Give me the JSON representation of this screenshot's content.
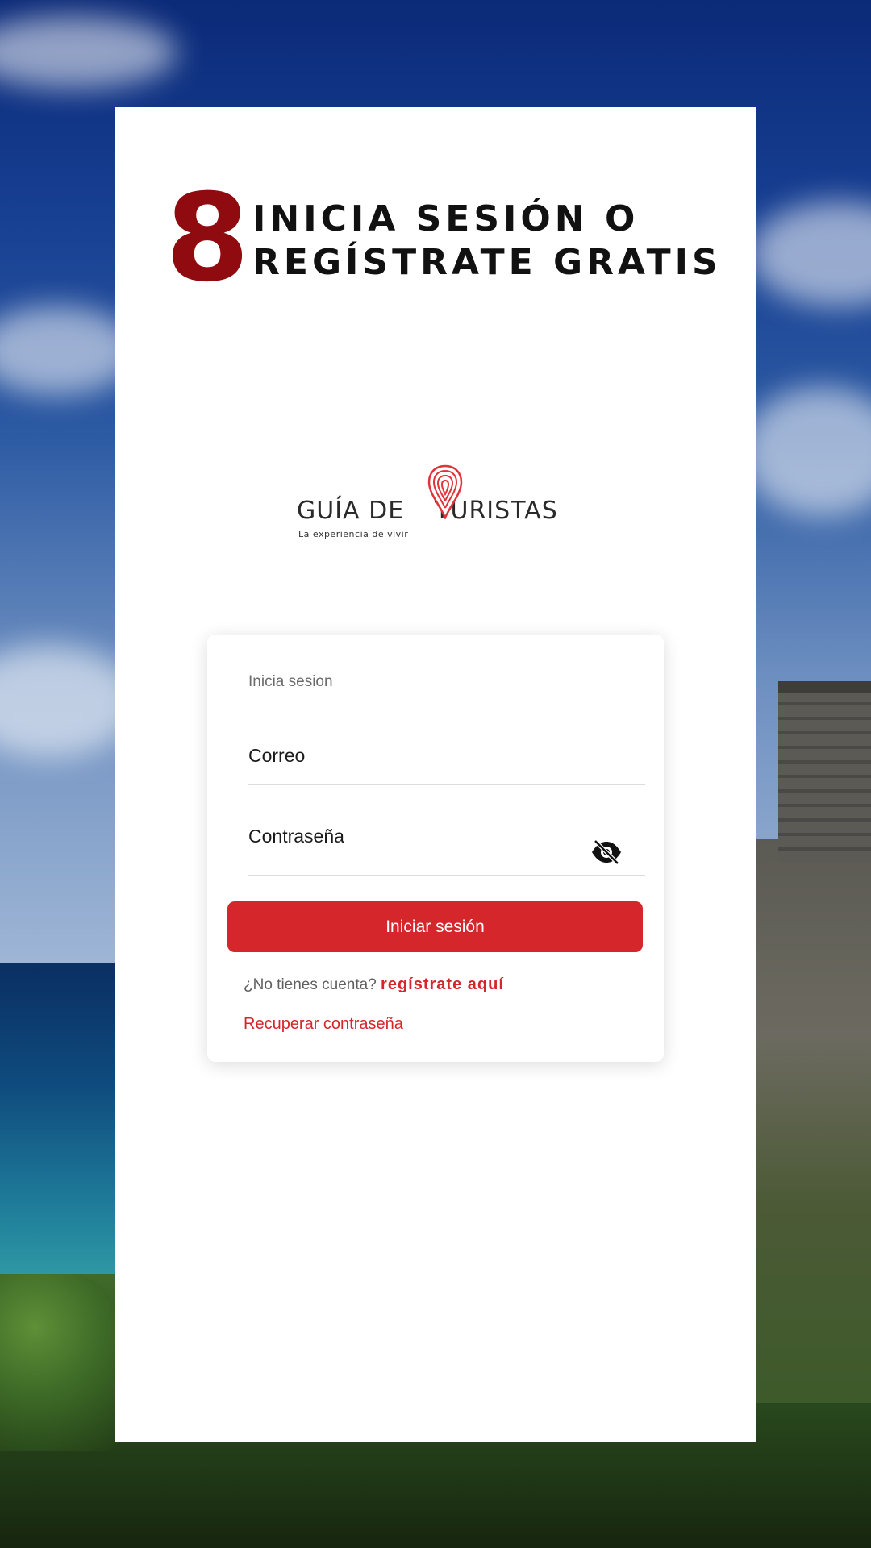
{
  "step": {
    "number": "8",
    "headline_line1": "INICIA SESIÓN O",
    "headline_line2": "REGÍSTRATE GRATIS"
  },
  "logo": {
    "name_part1": "GUÍA DE",
    "name_part2": "TURISTAS",
    "tagline": "La experiencia de vivir",
    "pin_icon": "map-pin-fingerprint-icon"
  },
  "login": {
    "title": "Inicia sesion",
    "email_placeholder": "Correo",
    "password_placeholder": "Contraseña",
    "password_toggle_icon": "eye-slash-icon",
    "submit_label": "Iniciar sesión",
    "no_account_text": "¿No tienes cuenta?",
    "signup_link": "regístrate aquí",
    "recover_link": "Recuperar contraseña"
  },
  "colors": {
    "brand_red": "#d4262b",
    "step_number": "#8f0b10",
    "headline": "#111111"
  }
}
